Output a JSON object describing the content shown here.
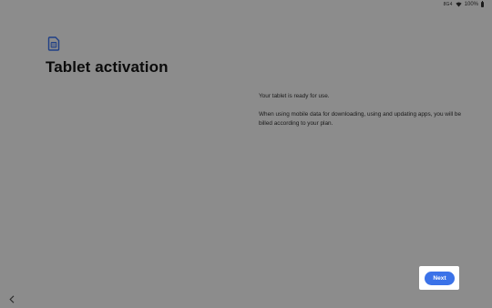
{
  "status_bar": {
    "signal_text": "8G4",
    "battery_percent": "100%",
    "wifi_icon": "wifi-icon",
    "battery_icon": "battery-icon"
  },
  "header": {
    "icon": "sim-card-icon",
    "title": "Tablet activation"
  },
  "body": {
    "paragraph_1": "Your tablet is ready for use.",
    "paragraph_2": "When using mobile data for downloading, using and updating apps, you will be billed according to your plan."
  },
  "footer": {
    "next_label": "Next",
    "back_icon": "chevron-left-icon"
  },
  "colors": {
    "background": "#8c8c8c",
    "accent": "#3b72e8",
    "icon": "#1f3f86"
  }
}
